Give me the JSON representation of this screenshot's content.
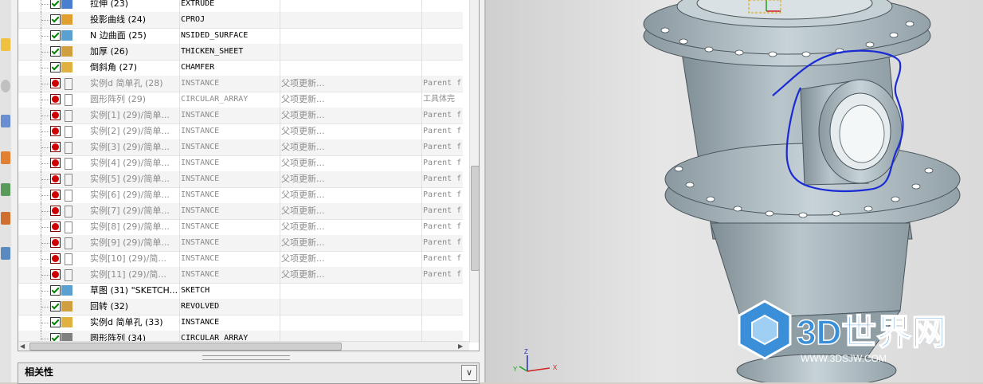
{
  "tree": {
    "rows": [
      {
        "name": "拉伸",
        "num": "(23)",
        "type": "EXTRUDE",
        "status": "",
        "warn": "",
        "ok": true,
        "dim": false
      },
      {
        "name": "投影曲线",
        "num": "(24)",
        "type": "CPROJ",
        "status": "",
        "warn": "",
        "ok": true,
        "dim": false
      },
      {
        "name": "N 边曲面",
        "num": "(25)",
        "type": "NSIDED_SURFACE",
        "status": "",
        "warn": "",
        "ok": true,
        "dim": false
      },
      {
        "name": "加厚",
        "num": "(26)",
        "type": "THICKEN_SHEET",
        "status": "",
        "warn": "",
        "ok": true,
        "dim": false
      },
      {
        "name": "倒斜角",
        "num": "(27)",
        "type": "CHAMFER",
        "status": "",
        "warn": "",
        "ok": true,
        "dim": false
      },
      {
        "name": "实例d 简单孔",
        "num": "(28)",
        "type": "INSTANCE",
        "status": "父项更新...",
        "warn": "Parent f",
        "ok": false,
        "dim": true
      },
      {
        "name": "圆形阵列",
        "num": "(29)",
        "type": "CIRCULAR_ARRAY",
        "status": "父项更新...",
        "warn": "工具体完",
        "ok": false,
        "dim": true
      },
      {
        "name": "实例[1]",
        "num": "(29)/简单...",
        "type": "INSTANCE",
        "status": "父项更新...",
        "warn": "Parent f",
        "ok": false,
        "dim": true
      },
      {
        "name": "实例[2]",
        "num": "(29)/简单...",
        "type": "INSTANCE",
        "status": "父项更新...",
        "warn": "Parent f",
        "ok": false,
        "dim": true
      },
      {
        "name": "实例[3]",
        "num": "(29)/简单...",
        "type": "INSTANCE",
        "status": "父项更新...",
        "warn": "Parent f",
        "ok": false,
        "dim": true
      },
      {
        "name": "实例[4]",
        "num": "(29)/简单...",
        "type": "INSTANCE",
        "status": "父项更新...",
        "warn": "Parent f",
        "ok": false,
        "dim": true
      },
      {
        "name": "实例[5]",
        "num": "(29)/简单...",
        "type": "INSTANCE",
        "status": "父项更新...",
        "warn": "Parent f",
        "ok": false,
        "dim": true
      },
      {
        "name": "实例[6]",
        "num": "(29)/简单...",
        "type": "INSTANCE",
        "status": "父项更新...",
        "warn": "Parent f",
        "ok": false,
        "dim": true
      },
      {
        "name": "实例[7]",
        "num": "(29)/简单...",
        "type": "INSTANCE",
        "status": "父项更新...",
        "warn": "Parent f",
        "ok": false,
        "dim": true
      },
      {
        "name": "实例[8]",
        "num": "(29)/简单...",
        "type": "INSTANCE",
        "status": "父项更新...",
        "warn": "Parent f",
        "ok": false,
        "dim": true
      },
      {
        "name": "实例[9]",
        "num": "(29)/简单...",
        "type": "INSTANCE",
        "status": "父项更新...",
        "warn": "Parent f",
        "ok": false,
        "dim": true
      },
      {
        "name": "实例[10]",
        "num": "(29)/简...",
        "type": "INSTANCE",
        "status": "父项更新...",
        "warn": "Parent f",
        "ok": false,
        "dim": true
      },
      {
        "name": "实例[11]",
        "num": "(29)/简...",
        "type": "INSTANCE",
        "status": "父项更新...",
        "warn": "Parent f",
        "ok": false,
        "dim": true
      },
      {
        "name": "草图",
        "num": "(31) \"SKETCH...",
        "type": "SKETCH",
        "status": "",
        "warn": "",
        "ok": true,
        "dim": false
      },
      {
        "name": "回转",
        "num": "(32)",
        "type": "REVOLVED",
        "status": "",
        "warn": "",
        "ok": true,
        "dim": false
      },
      {
        "name": "实例d 简单孔",
        "num": "(33)",
        "type": "INSTANCE",
        "status": "",
        "warn": "",
        "ok": true,
        "dim": false
      },
      {
        "name": "圆形阵列",
        "num": "(34)",
        "type": "CIRCULAR_ARRAY",
        "status": "",
        "warn": "",
        "ok": true,
        "dim": false
      }
    ]
  },
  "dependency_panel": {
    "title": "相关性",
    "toggle_icon": "chevron-down-icon"
  },
  "viewport": {
    "watermark_main": "3D世界网",
    "watermark_sub": "WWW.3DSJW.COM",
    "triad": {
      "x": "X",
      "y": "Y",
      "z": "Z"
    }
  },
  "colors": {
    "ok_check": "#008000",
    "error_badge": "#d00000",
    "annotation_stroke": "#1a2bd6",
    "model_fill": "#a9b6bc"
  }
}
